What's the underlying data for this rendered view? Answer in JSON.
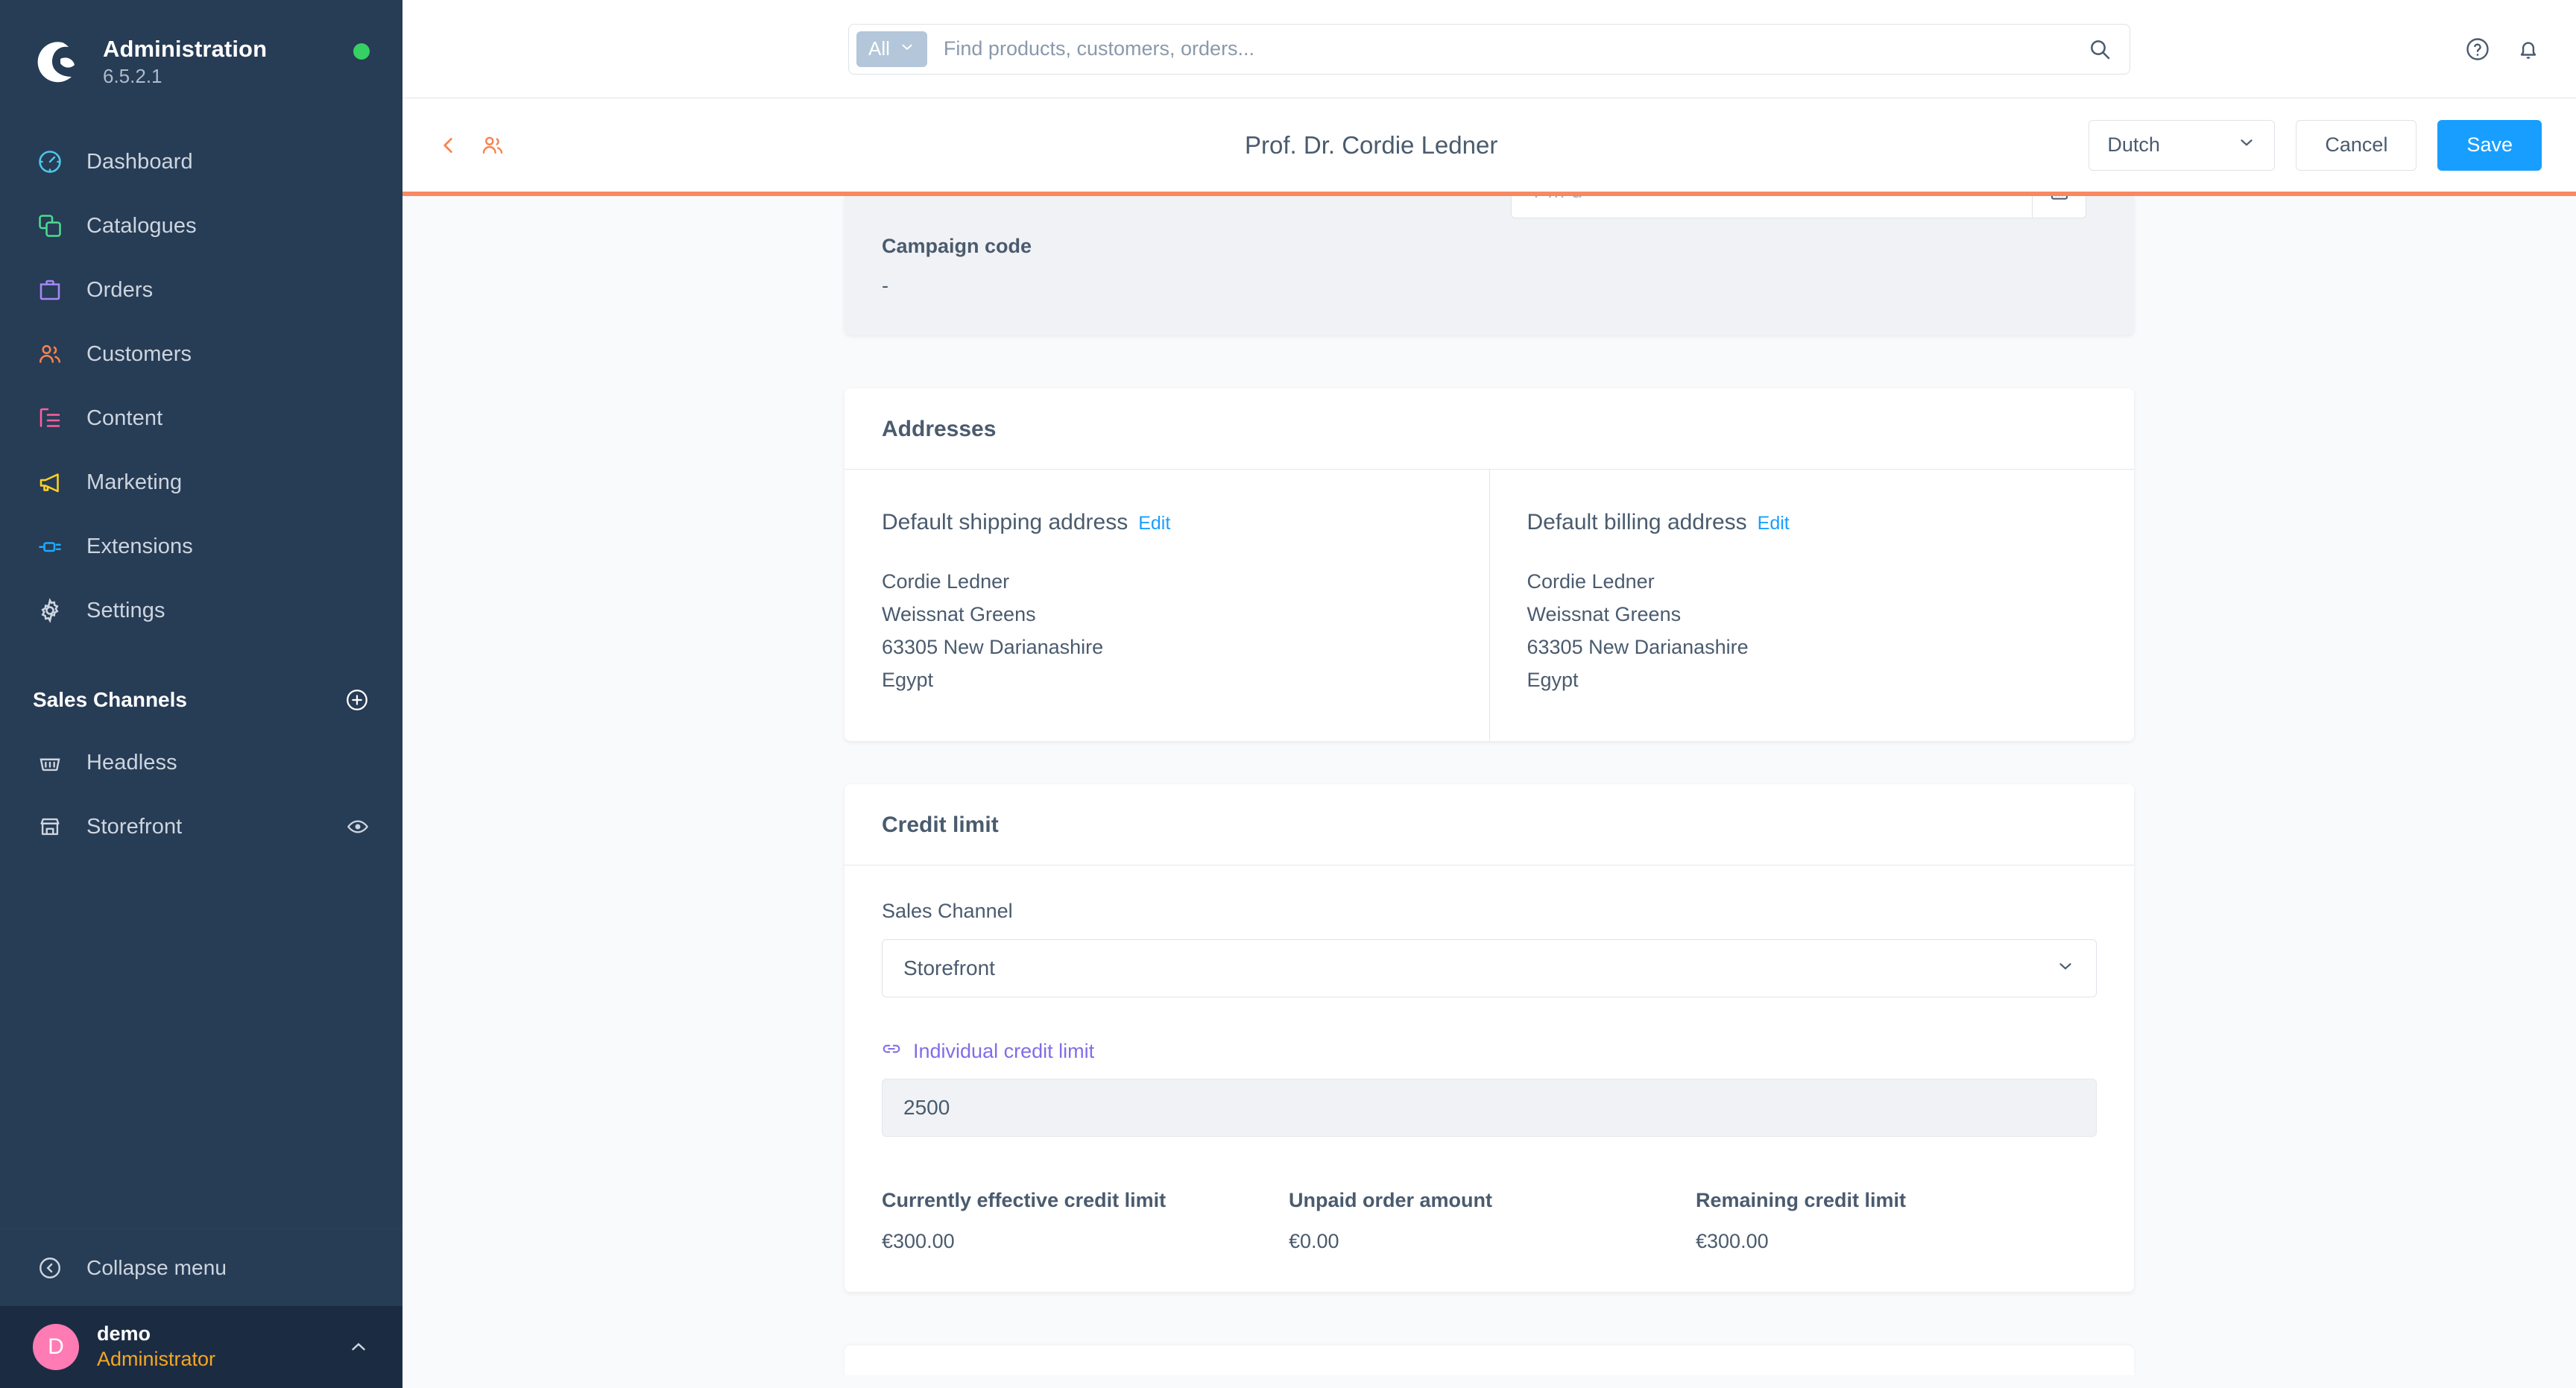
{
  "sidebar": {
    "app_title": "Administration",
    "version": "6.5.2.1",
    "status_dot_color": "#37d064",
    "nav": [
      {
        "label": "Dashboard",
        "icon": "dashboard-gauge-icon",
        "color": "#4dc6e8"
      },
      {
        "label": "Catalogues",
        "icon": "catalogue-stack-icon",
        "color": "#4ddb8f"
      },
      {
        "label": "Orders",
        "icon": "orders-bag-icon",
        "color": "#a787f7"
      },
      {
        "label": "Customers",
        "icon": "customers-people-icon",
        "color": "#f7834f"
      },
      {
        "label": "Content",
        "icon": "content-layout-icon",
        "color": "#ff5fa0"
      },
      {
        "label": "Marketing",
        "icon": "marketing-megaphone-icon",
        "color": "#ffd21f"
      },
      {
        "label": "Extensions",
        "icon": "extensions-plug-icon",
        "color": "#1cabff"
      },
      {
        "label": "Settings",
        "icon": "settings-gear-icon",
        "color": "#cdd5df"
      }
    ],
    "section": {
      "title": "Sales Channels",
      "add_icon": "plus-circle-icon"
    },
    "channels": [
      {
        "label": "Headless",
        "icon": "basket-icon",
        "trail_icon": null
      },
      {
        "label": "Storefront",
        "icon": "storefront-icon",
        "trail_icon": "eye-icon"
      }
    ],
    "collapse": {
      "label": "Collapse menu",
      "icon": "chevron-left-circle-icon"
    },
    "user": {
      "avatar_initial": "D",
      "avatar_color": "#ff7bb4",
      "name": "demo",
      "role": "Administrator",
      "caret_icon": "chevron-up-icon"
    }
  },
  "topbar": {
    "scope_label": "All",
    "scope_caret_icon": "chevron-down-icon",
    "search_value": "",
    "search_placeholder": "Find products, customers, orders...",
    "search_icon": "search-icon",
    "help_icon": "help-circle-icon",
    "notification_icon": "bell-icon"
  },
  "smartbar": {
    "back_icon": "chevron-left-icon",
    "entity_icon": "customers-people-icon",
    "title": "Prof. Dr. Cordie Ledner",
    "language": "Dutch",
    "language_caret_icon": "chevron-down-icon",
    "cancel_label": "Cancel",
    "save_label": "Save",
    "save_color": "#189eff",
    "loading_bar_color": "#f88962"
  },
  "content": {
    "top_card": {
      "date_value": "",
      "date_placeholder": "Y-m-d",
      "date_icon": "calendar-icon",
      "campaign_label": "Campaign code",
      "campaign_value": "-"
    },
    "addresses": {
      "title": "Addresses",
      "columns": [
        {
          "heading": "Default shipping address",
          "edit_label": "Edit",
          "lines": [
            "Cordie Ledner",
            "Weissnat Greens",
            "63305 New Darianashire",
            "Egypt"
          ]
        },
        {
          "heading": "Default billing address",
          "edit_label": "Edit",
          "lines": [
            "Cordie Ledner",
            "Weissnat Greens",
            "63305 New Darianashire",
            "Egypt"
          ]
        }
      ]
    },
    "credit_limit": {
      "title": "Credit limit",
      "sales_channel_label": "Sales Channel",
      "sales_channel_value": "Storefront",
      "sales_channel_caret_icon": "chevron-down-icon",
      "individual_limit_label": "Individual credit limit",
      "individual_limit_icon": "link-chain-icon",
      "individual_limit_color": "#7f6ee8",
      "individual_limit_value": "2500",
      "stats": [
        {
          "label": "Currently effective credit limit",
          "value": "€300.00"
        },
        {
          "label": "Unpaid order amount",
          "value": "€0.00"
        },
        {
          "label": "Remaining credit limit",
          "value": "€300.00"
        }
      ]
    }
  }
}
